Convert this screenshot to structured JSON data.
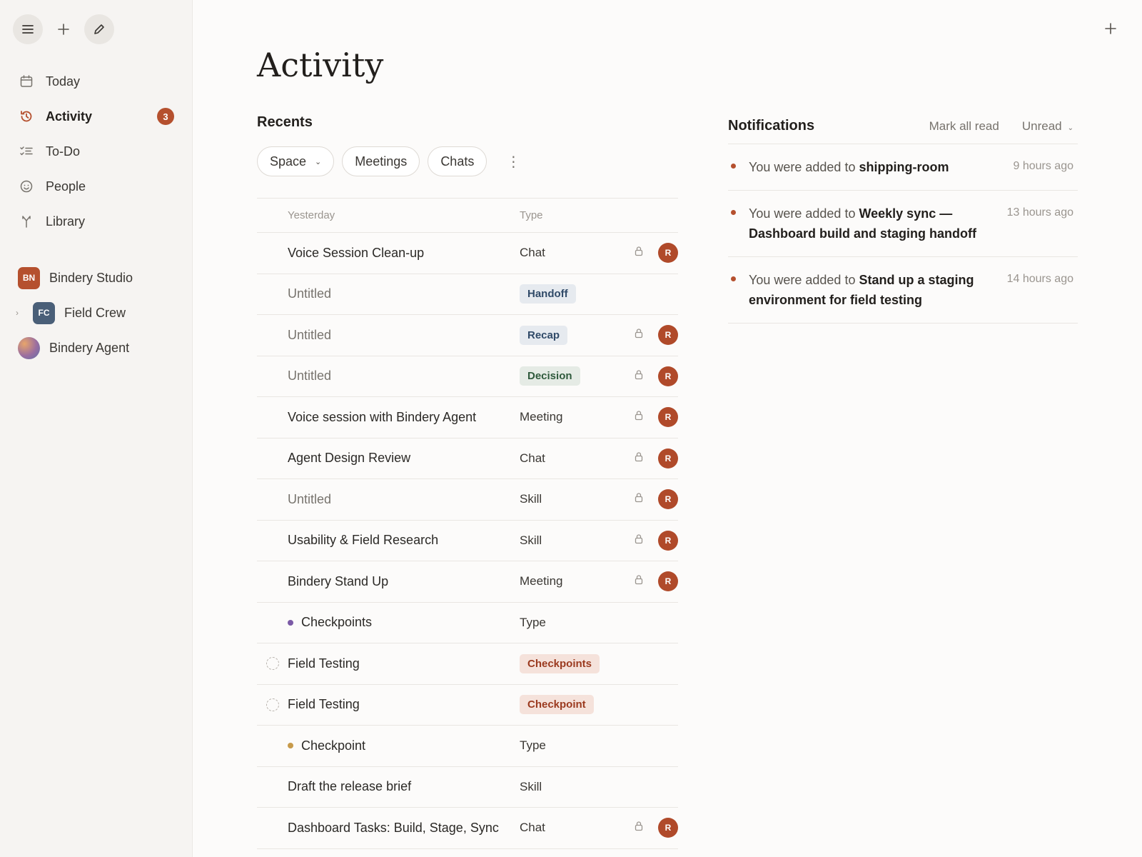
{
  "sidebar": {
    "nav": [
      {
        "label": "Today",
        "icon": "calendar-icon"
      },
      {
        "label": "Activity",
        "icon": "history-icon",
        "badge": "3",
        "active": true
      },
      {
        "label": "To-Do",
        "icon": "checklist-icon"
      },
      {
        "label": "People",
        "icon": "smile-icon"
      },
      {
        "label": "Library",
        "icon": "fork-icon"
      }
    ],
    "spaces": [
      {
        "initials": "BN",
        "label": "Bindery Studio",
        "color": "#b5502e"
      },
      {
        "initials": "FC",
        "label": "Field Crew",
        "color": "#4a5f78"
      },
      {
        "label": "Bindery Agent"
      }
    ]
  },
  "main": {
    "title": "Activity",
    "recents_heading": "Recents",
    "filters": {
      "space": "Space",
      "meetings": "Meetings",
      "chats": "Chats"
    },
    "table": {
      "header": {
        "name": "Yesterday",
        "type": "Type"
      },
      "rows": [
        {
          "name": "Voice Session Clean-up",
          "type": "Chat",
          "lock": true,
          "avatar": "R"
        },
        {
          "name": "Untitled",
          "muted": true,
          "tag": "Handoff",
          "tag_style": "blue",
          "lock": false,
          "avatar": ""
        },
        {
          "name": "Untitled",
          "muted": true,
          "tag": "Recap",
          "tag_style": "blue",
          "lock": true,
          "avatar": "R"
        },
        {
          "name": "Untitled",
          "muted": true,
          "tag": "Decision",
          "tag_style": "green",
          "lock": true,
          "avatar": "R"
        },
        {
          "name": "Voice session with Bindery Agent",
          "type": "Meeting",
          "lock": true,
          "avatar": "R"
        },
        {
          "name": "Agent Design Review",
          "type": "Chat",
          "lock": true,
          "avatar": "R"
        },
        {
          "name": "Untitled",
          "muted": true,
          "type": "Skill",
          "lock": true,
          "avatar": "R"
        },
        {
          "name": "Usability & Field Research",
          "type": "Skill",
          "lock": true,
          "avatar": "R"
        },
        {
          "name": "Bindery Stand Up",
          "type": "Meeting",
          "lock": true,
          "avatar": "R"
        },
        {
          "name": "Checkpoints",
          "dot": "#7b5aa6",
          "type": "Type",
          "lock": false,
          "avatar": ""
        },
        {
          "name": "Field Testing",
          "check": true,
          "tag": "Checkpoints",
          "tag_style": "red",
          "lock": false,
          "avatar": ""
        },
        {
          "name": "Field Testing",
          "check": true,
          "tag": "Checkpoint",
          "tag_style": "red",
          "lock": false,
          "avatar": ""
        },
        {
          "name": "Checkpoint",
          "dot": "#c79a4a",
          "type": "Type",
          "lock": false,
          "avatar": ""
        },
        {
          "name": "Draft the release brief",
          "type": "Skill",
          "lock": false,
          "avatar": ""
        },
        {
          "name": "Dashboard Tasks: Build, Stage, Sync",
          "type": "Chat",
          "lock": true,
          "avatar": "R"
        }
      ]
    }
  },
  "notifications": {
    "title": "Notifications",
    "mark_all_read": "Mark all read",
    "filter": "Unread",
    "items": [
      {
        "prefix": "You were added to ",
        "target": "shipping-room",
        "time": "9 hours ago"
      },
      {
        "prefix": "You were added to ",
        "target": "Weekly sync — Dashboard build and staging handoff",
        "time": "13 hours ago"
      },
      {
        "prefix": "You were added to ",
        "target": "Stand up a staging environment for field testing",
        "time": "14 hours ago"
      }
    ]
  },
  "colors": {
    "accent": "#b5502e",
    "background": "#fcfbfa",
    "sidebar": "#f6f4f2"
  }
}
